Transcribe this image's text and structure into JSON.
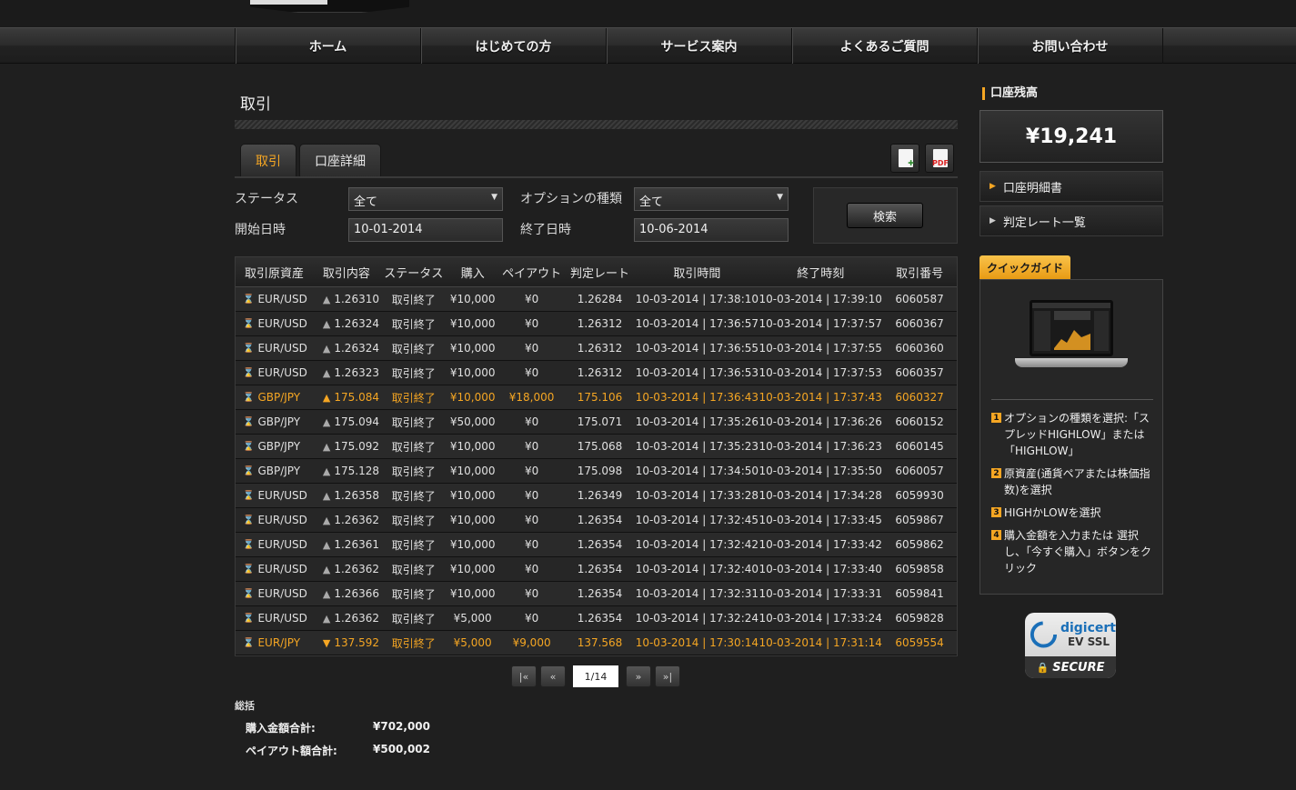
{
  "nav": [
    "ホーム",
    "はじめての方",
    "サービス案内",
    "よくあるご質問",
    "お問い合わせ"
  ],
  "page_title": "取引",
  "tabs": [
    {
      "label": "取引",
      "active": true
    },
    {
      "label": "口座詳細",
      "active": false
    }
  ],
  "export": {
    "excel_icon": "excel-icon",
    "pdf_icon": "pdf-icon",
    "pdf_mark": "PDF"
  },
  "filters": {
    "status_label": "ステータス",
    "status_value": "全て",
    "option_type_label": "オプションの種類",
    "option_type_value": "全て",
    "start_label": "開始日時",
    "start_value": "10-01-2014",
    "end_label": "終了日時",
    "end_value": "10-06-2014",
    "search_button": "検索"
  },
  "table": {
    "headers": [
      "取引原資産",
      "取引内容",
      "ステータス",
      "購入",
      "ペイアウト",
      "判定レート",
      "取引時間",
      "終了時刻",
      "取引番号"
    ],
    "rows": [
      {
        "asset": "EUR/USD",
        "dir": "up",
        "rate": "1.26310",
        "status": "取引終了",
        "buy": "¥10,000",
        "payout": "¥0",
        "judge": "1.26284",
        "start": "10-03-2014 | 17:38:10",
        "end": "10-03-2014 | 17:39:10",
        "id": "6060587",
        "win": false
      },
      {
        "asset": "EUR/USD",
        "dir": "up",
        "rate": "1.26324",
        "status": "取引終了",
        "buy": "¥10,000",
        "payout": "¥0",
        "judge": "1.26312",
        "start": "10-03-2014 | 17:36:57",
        "end": "10-03-2014 | 17:37:57",
        "id": "6060367",
        "win": false
      },
      {
        "asset": "EUR/USD",
        "dir": "up",
        "rate": "1.26324",
        "status": "取引終了",
        "buy": "¥10,000",
        "payout": "¥0",
        "judge": "1.26312",
        "start": "10-03-2014 | 17:36:55",
        "end": "10-03-2014 | 17:37:55",
        "id": "6060360",
        "win": false
      },
      {
        "asset": "EUR/USD",
        "dir": "up",
        "rate": "1.26323",
        "status": "取引終了",
        "buy": "¥10,000",
        "payout": "¥0",
        "judge": "1.26312",
        "start": "10-03-2014 | 17:36:53",
        "end": "10-03-2014 | 17:37:53",
        "id": "6060357",
        "win": false
      },
      {
        "asset": "GBP/JPY",
        "dir": "up",
        "rate": "175.084",
        "status": "取引終了",
        "buy": "¥10,000",
        "payout": "¥18,000",
        "judge": "175.106",
        "start": "10-03-2014 | 17:36:43",
        "end": "10-03-2014 | 17:37:43",
        "id": "6060327",
        "win": true
      },
      {
        "asset": "GBP/JPY",
        "dir": "up",
        "rate": "175.094",
        "status": "取引終了",
        "buy": "¥50,000",
        "payout": "¥0",
        "judge": "175.071",
        "start": "10-03-2014 | 17:35:26",
        "end": "10-03-2014 | 17:36:26",
        "id": "6060152",
        "win": false
      },
      {
        "asset": "GBP/JPY",
        "dir": "up",
        "rate": "175.092",
        "status": "取引終了",
        "buy": "¥10,000",
        "payout": "¥0",
        "judge": "175.068",
        "start": "10-03-2014 | 17:35:23",
        "end": "10-03-2014 | 17:36:23",
        "id": "6060145",
        "win": false
      },
      {
        "asset": "GBP/JPY",
        "dir": "up",
        "rate": "175.128",
        "status": "取引終了",
        "buy": "¥10,000",
        "payout": "¥0",
        "judge": "175.098",
        "start": "10-03-2014 | 17:34:50",
        "end": "10-03-2014 | 17:35:50",
        "id": "6060057",
        "win": false
      },
      {
        "asset": "EUR/USD",
        "dir": "up",
        "rate": "1.26358",
        "status": "取引終了",
        "buy": "¥10,000",
        "payout": "¥0",
        "judge": "1.26349",
        "start": "10-03-2014 | 17:33:28",
        "end": "10-03-2014 | 17:34:28",
        "id": "6059930",
        "win": false
      },
      {
        "asset": "EUR/USD",
        "dir": "up",
        "rate": "1.26362",
        "status": "取引終了",
        "buy": "¥10,000",
        "payout": "¥0",
        "judge": "1.26354",
        "start": "10-03-2014 | 17:32:45",
        "end": "10-03-2014 | 17:33:45",
        "id": "6059867",
        "win": false
      },
      {
        "asset": "EUR/USD",
        "dir": "up",
        "rate": "1.26361",
        "status": "取引終了",
        "buy": "¥10,000",
        "payout": "¥0",
        "judge": "1.26354",
        "start": "10-03-2014 | 17:32:42",
        "end": "10-03-2014 | 17:33:42",
        "id": "6059862",
        "win": false
      },
      {
        "asset": "EUR/USD",
        "dir": "up",
        "rate": "1.26362",
        "status": "取引終了",
        "buy": "¥10,000",
        "payout": "¥0",
        "judge": "1.26354",
        "start": "10-03-2014 | 17:32:40",
        "end": "10-03-2014 | 17:33:40",
        "id": "6059858",
        "win": false
      },
      {
        "asset": "EUR/USD",
        "dir": "up",
        "rate": "1.26366",
        "status": "取引終了",
        "buy": "¥10,000",
        "payout": "¥0",
        "judge": "1.26354",
        "start": "10-03-2014 | 17:32:31",
        "end": "10-03-2014 | 17:33:31",
        "id": "6059841",
        "win": false
      },
      {
        "asset": "EUR/USD",
        "dir": "up",
        "rate": "1.26362",
        "status": "取引終了",
        "buy": "¥5,000",
        "payout": "¥0",
        "judge": "1.26354",
        "start": "10-03-2014 | 17:32:24",
        "end": "10-03-2014 | 17:33:24",
        "id": "6059828",
        "win": false
      },
      {
        "asset": "EUR/JPY",
        "dir": "down",
        "rate": "137.592",
        "status": "取引終了",
        "buy": "¥5,000",
        "payout": "¥9,000",
        "judge": "137.568",
        "start": "10-03-2014 | 17:30:14",
        "end": "10-03-2014 | 17:31:14",
        "id": "6059554",
        "win": true
      }
    ]
  },
  "pager": {
    "first": "|«",
    "prev": "«",
    "page": "1/14",
    "next": "»",
    "last": "»|"
  },
  "summary": {
    "title": "総括",
    "buy_total_label": "購入金額合計:",
    "buy_total_value": "¥702,000",
    "payout_total_label": "ペイアウト額合計:",
    "payout_total_value": "¥500,002"
  },
  "sidebar": {
    "balance_label": "口座残高",
    "balance_value": "¥19,241",
    "links": [
      "口座明細書",
      "判定レート一覧"
    ],
    "quick_guide_label": "クイックガイド",
    "steps": [
      {
        "n": "1",
        "text": "オプションの種類を選択:「スプレッドHIGHLOW」または「HIGHLOW」"
      },
      {
        "n": "2",
        "text": "原資産(通貨ペアまたは株価指数)を選択"
      },
      {
        "n": "3",
        "text": "HIGHかLOWを選択"
      },
      {
        "n": "4",
        "text": "購入金額を入力または 選択し、「今すぐ購入」ボタンをクリック"
      }
    ],
    "ssl_badge": {
      "brand": "digicert",
      "line2": "EV SSL",
      "secure": "SECURE"
    }
  },
  "colors": {
    "accent": "#f5a623",
    "background": "#1f1f1f"
  }
}
